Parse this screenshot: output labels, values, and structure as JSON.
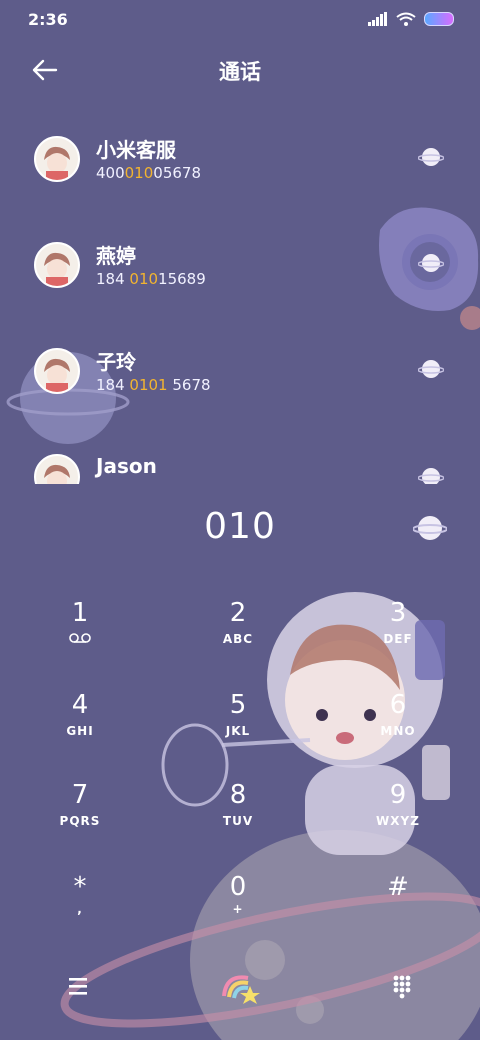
{
  "status": {
    "time": "2:36"
  },
  "header": {
    "title": "通话"
  },
  "contacts": [
    {
      "name": "小米客服",
      "num_pre": "400",
      "num_hl": "010",
      "num_post": "05678"
    },
    {
      "name": "燕婷",
      "num_pre": "184 ",
      "num_hl": "010",
      "num_post": "15689"
    },
    {
      "name": "子玲",
      "num_pre": "184 ",
      "num_hl": "0101",
      "num_post": " 5678"
    },
    {
      "name": "Jason",
      "num_pre": "",
      "num_hl": "",
      "num_post": ""
    }
  ],
  "dialer": {
    "input": "010"
  },
  "keys": [
    {
      "digit": "1",
      "letters": ""
    },
    {
      "digit": "2",
      "letters": "ABC"
    },
    {
      "digit": "3",
      "letters": "DEF"
    },
    {
      "digit": "4",
      "letters": "GHI"
    },
    {
      "digit": "5",
      "letters": "JKL"
    },
    {
      "digit": "6",
      "letters": "MNO"
    },
    {
      "digit": "7",
      "letters": "PQRS"
    },
    {
      "digit": "8",
      "letters": "TUV"
    },
    {
      "digit": "9",
      "letters": "WXYZ"
    },
    {
      "digit": "*",
      "letters": ","
    },
    {
      "digit": "0",
      "letters": "+"
    },
    {
      "digit": "#",
      "letters": ""
    }
  ],
  "colors": {
    "background": "#5e5c8a",
    "highlight": "#f2b430"
  },
  "icons": {
    "back": "arrow-left-icon",
    "call": "planet-icon",
    "voicemail": "voicemail-icon",
    "menu": "menu-icon",
    "dial": "rainbow-star-icon",
    "keypad": "keypad-icon"
  }
}
